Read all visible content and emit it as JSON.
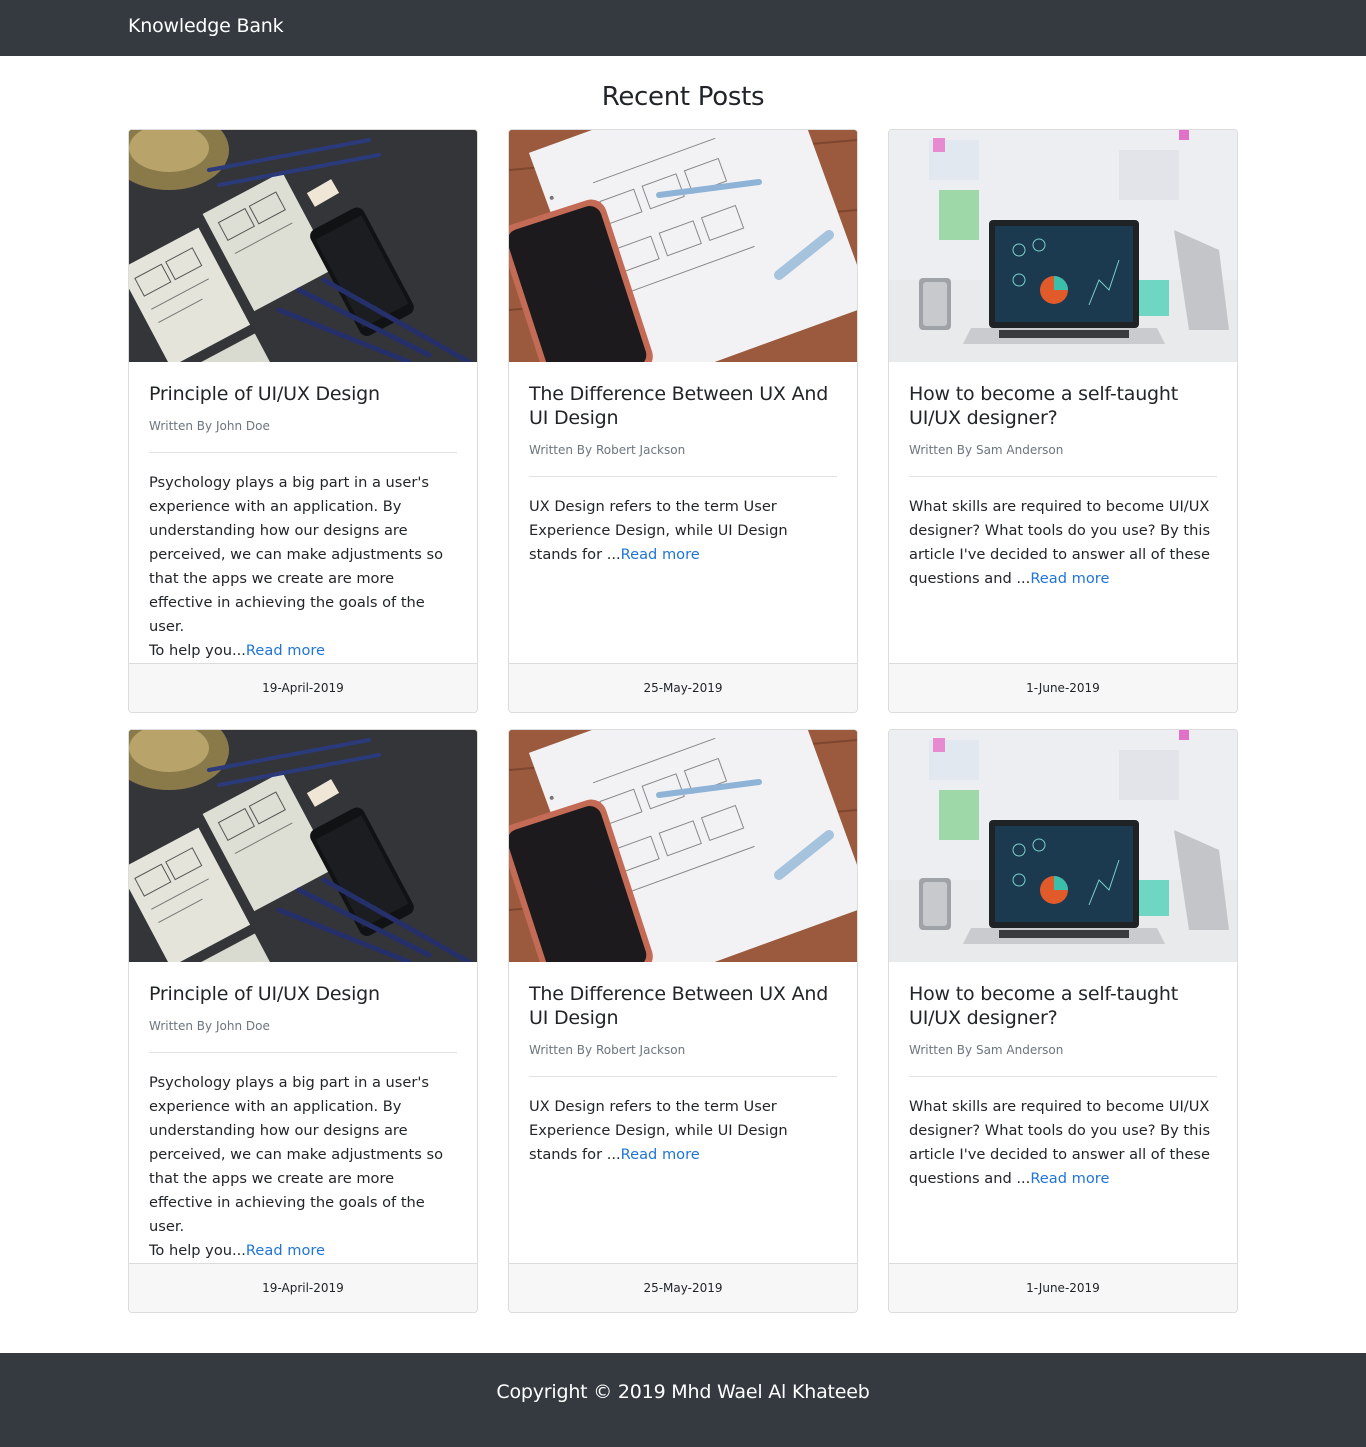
{
  "navbar": {
    "brand": "Knowledge Bank"
  },
  "page": {
    "title": "Recent Posts"
  },
  "posts": [
    {
      "title": "Principle of UI/UX Design",
      "author": "Written By John Doe",
      "excerpt": "Psychology plays a big part in a user's experience with an application. By understanding how our designs are perceived, we can make adjustments so that the apps we create are more effective in achieving the goals of the user.",
      "excerpt_tail": "To help you...",
      "read_more": "Read more",
      "date": "19-April-2019",
      "image": "wireframe-sketches-desk-photo"
    },
    {
      "title": "The Difference Between UX And UI Design",
      "author": "Written By Robert Jackson",
      "excerpt": "UX Design refers to the term User Experience Design, while UI Design stands for ...",
      "excerpt_tail": "",
      "read_more": "Read more",
      "date": "25-May-2019",
      "image": "notebook-wireframe-photo"
    },
    {
      "title": "How to become a self-taught UI/UX designer?",
      "author": "Written By Sam Anderson",
      "excerpt": "What skills are required to become UI/UX designer? What tools do you use? By this article I've decided to answer all of these questions and ...",
      "excerpt_tail": "",
      "read_more": "Read more",
      "date": "1-June-2019",
      "image": "laptop-dashboard-photo"
    },
    {
      "title": "Principle of UI/UX Design",
      "author": "Written By John Doe",
      "excerpt": "Psychology plays a big part in a user's experience with an application. By understanding how our designs are perceived, we can make adjustments so that the apps we create are more effective in achieving the goals of the user.",
      "excerpt_tail": "To help you...",
      "read_more": "Read more",
      "date": "19-April-2019",
      "image": "wireframe-sketches-desk-photo"
    },
    {
      "title": "The Difference Between UX And UI Design",
      "author": "Written By Robert Jackson",
      "excerpt": "UX Design refers to the term User Experience Design, while UI Design stands for ...",
      "excerpt_tail": "",
      "read_more": "Read more",
      "date": "25-May-2019",
      "image": "notebook-wireframe-photo"
    },
    {
      "title": "How to become a self-taught UI/UX designer?",
      "author": "Written By Sam Anderson",
      "excerpt": "What skills are required to become UI/UX designer? What tools do you use? By this article I've decided to answer all of these questions and ...",
      "excerpt_tail": "",
      "read_more": "Read more",
      "date": "1-June-2019",
      "image": "laptop-dashboard-photo"
    }
  ],
  "footer": {
    "copyright": "Copyright © 2019 Mhd Wael Al Khateeb"
  }
}
